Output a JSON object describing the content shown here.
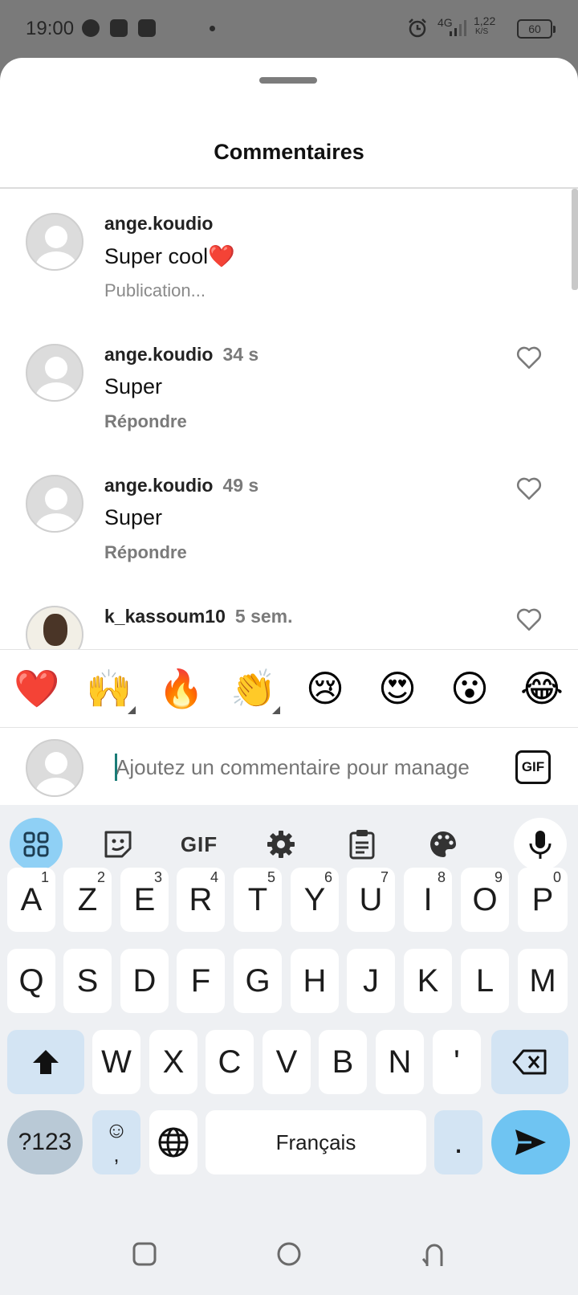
{
  "status_bar": {
    "time": "19:00",
    "network": "4G",
    "speed": "1,22",
    "speed_unit": "K/S",
    "battery": "60"
  },
  "sheet": {
    "title": "Commentaires"
  },
  "comments": [
    {
      "username": "ange.koudio",
      "time": "",
      "text": "Super cool❤️",
      "status": "Publication...",
      "reply": ""
    },
    {
      "username": "ange.koudio",
      "time": "34 s",
      "text": "Super",
      "status": "",
      "reply": "Répondre"
    },
    {
      "username": "ange.koudio",
      "time": "49 s",
      "text": "Super",
      "status": "",
      "reply": "Répondre"
    },
    {
      "username": "k_kassoum10",
      "time": "5 sem.",
      "text": "",
      "status": "",
      "reply": ""
    }
  ],
  "emoji_bar": [
    "❤️",
    "🙌",
    "🔥",
    "👏",
    "😢",
    "😍",
    "😮",
    "😂"
  ],
  "compose": {
    "placeholder": "Ajoutez un commentaire pour manage",
    "gif_label": "GIF"
  },
  "keyboard": {
    "toolbar_gif": "GIF",
    "row1": [
      {
        "k": "A",
        "s": "1"
      },
      {
        "k": "Z",
        "s": "2"
      },
      {
        "k": "E",
        "s": "3"
      },
      {
        "k": "R",
        "s": "4"
      },
      {
        "k": "T",
        "s": "5"
      },
      {
        "k": "Y",
        "s": "6"
      },
      {
        "k": "U",
        "s": "7"
      },
      {
        "k": "I",
        "s": "8"
      },
      {
        "k": "O",
        "s": "9"
      },
      {
        "k": "P",
        "s": "0"
      }
    ],
    "row2": [
      "Q",
      "S",
      "D",
      "F",
      "G",
      "H",
      "J",
      "K",
      "L",
      "M"
    ],
    "row3": [
      "W",
      "X",
      "C",
      "V",
      "B",
      "N",
      "'"
    ],
    "symbols_label": "?123",
    "emoji_key": "☺",
    "emoji_key_sub": ",",
    "space_label": "Français",
    "period_label": "."
  }
}
